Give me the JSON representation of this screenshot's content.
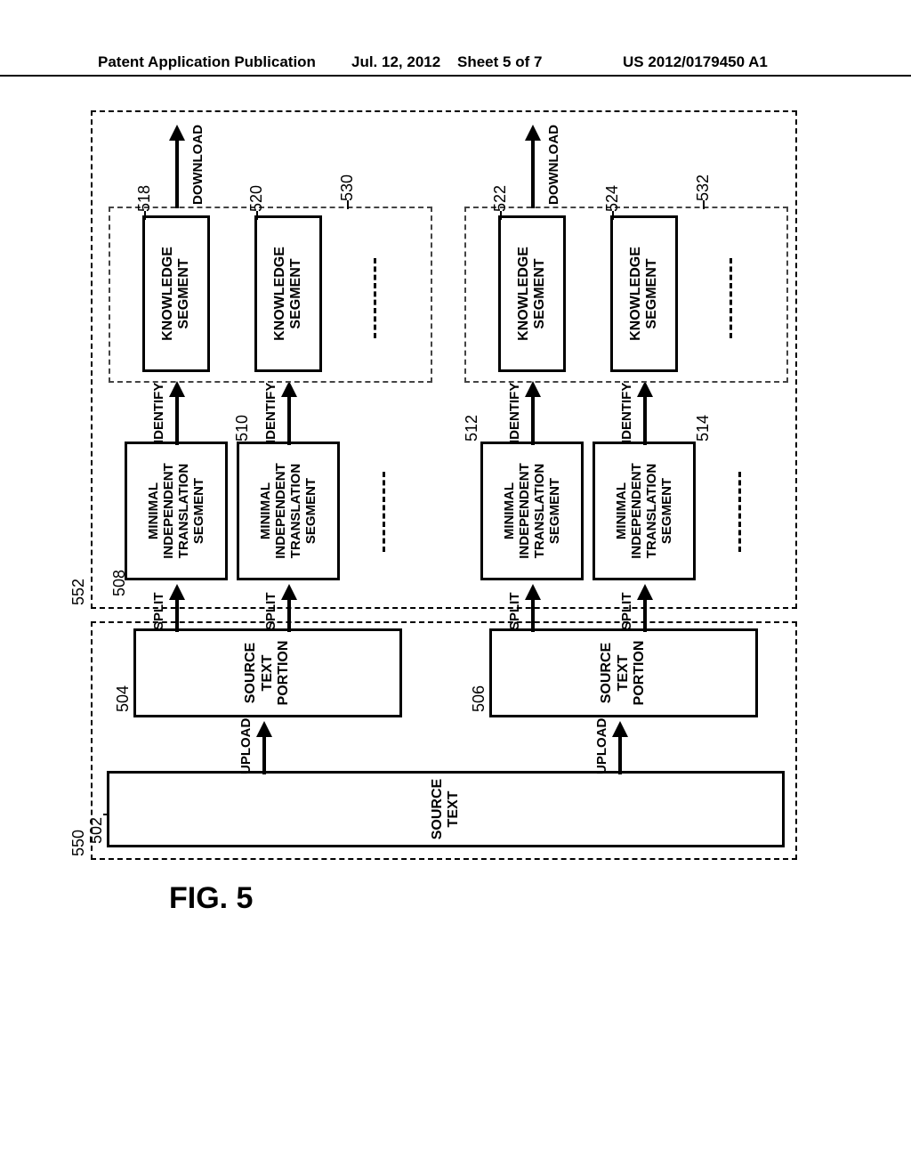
{
  "header": {
    "left": "Patent Application Publication",
    "date": "Jul. 12, 2012",
    "sheet": "Sheet 5 of 7",
    "pubno": "US 2012/0179450 A1"
  },
  "figure_label": "FIG. 5",
  "refs": {
    "r502": "502",
    "r504": "504",
    "r506": "506",
    "r508": "508",
    "r510": "510",
    "r512": "512",
    "r514": "514",
    "r518": "518",
    "r520": "520",
    "r522": "522",
    "r524": "524",
    "r530": "530",
    "r532": "532",
    "r550": "550",
    "r552": "552"
  },
  "labels": {
    "source_text": "SOURCE\nTEXT",
    "upload": "UPLOAD",
    "stp": "SOURCE\nTEXT\nPORTION",
    "split": "SPLIT",
    "mits": "MINIMAL\nINDEPENDENT\nTRANSLATION\nSEGMENT",
    "identify": "IDENTIFY",
    "ks": "KNOWLEDGE\nSEGMENT",
    "download": "DOWNLOAD"
  },
  "chart_data": {
    "type": "flow-diagram",
    "title": "FIG. 5",
    "nodes": [
      {
        "id": 502,
        "label": "SOURCE TEXT"
      },
      {
        "id": 504,
        "label": "SOURCE TEXT PORTION"
      },
      {
        "id": 506,
        "label": "SOURCE TEXT PORTION"
      },
      {
        "id": 508,
        "label": "MINIMAL INDEPENDENT TRANSLATION SEGMENT"
      },
      {
        "id": 510,
        "label": "MINIMAL INDEPENDENT TRANSLATION SEGMENT"
      },
      {
        "id": 512,
        "label": "MINIMAL INDEPENDENT TRANSLATION SEGMENT"
      },
      {
        "id": 514,
        "label": "MINIMAL INDEPENDENT TRANSLATION SEGMENT"
      },
      {
        "id": 518,
        "label": "KNOWLEDGE SEGMENT"
      },
      {
        "id": 520,
        "label": "KNOWLEDGE SEGMENT"
      },
      {
        "id": 522,
        "label": "KNOWLEDGE SEGMENT"
      },
      {
        "id": 524,
        "label": "KNOWLEDGE SEGMENT"
      }
    ],
    "groups": [
      {
        "id": 550,
        "contains": [
          502,
          504,
          506
        ]
      },
      {
        "id": 552,
        "contains": [
          508,
          510,
          512,
          514,
          518,
          520,
          522,
          524,
          530,
          532
        ]
      },
      {
        "id": 530,
        "contains": [
          518,
          520
        ]
      },
      {
        "id": 532,
        "contains": [
          522,
          524
        ]
      }
    ],
    "edges": [
      {
        "from": 502,
        "to": 504,
        "label": "UPLOAD"
      },
      {
        "from": 502,
        "to": 506,
        "label": "UPLOAD"
      },
      {
        "from": 504,
        "to": 508,
        "label": "SPLIT"
      },
      {
        "from": 504,
        "to": 510,
        "label": "SPLIT"
      },
      {
        "from": 506,
        "to": 512,
        "label": "SPLIT"
      },
      {
        "from": 506,
        "to": 514,
        "label": "SPLIT"
      },
      {
        "from": 508,
        "to": 518,
        "label": "IDENTIFY"
      },
      {
        "from": 510,
        "to": 520,
        "label": "IDENTIFY"
      },
      {
        "from": 512,
        "to": 522,
        "label": "IDENTIFY"
      },
      {
        "from": 514,
        "to": 524,
        "label": "IDENTIFY"
      },
      {
        "from": 518,
        "to": null,
        "label": "DOWNLOAD"
      },
      {
        "from": 522,
        "to": null,
        "label": "DOWNLOAD"
      }
    ]
  }
}
